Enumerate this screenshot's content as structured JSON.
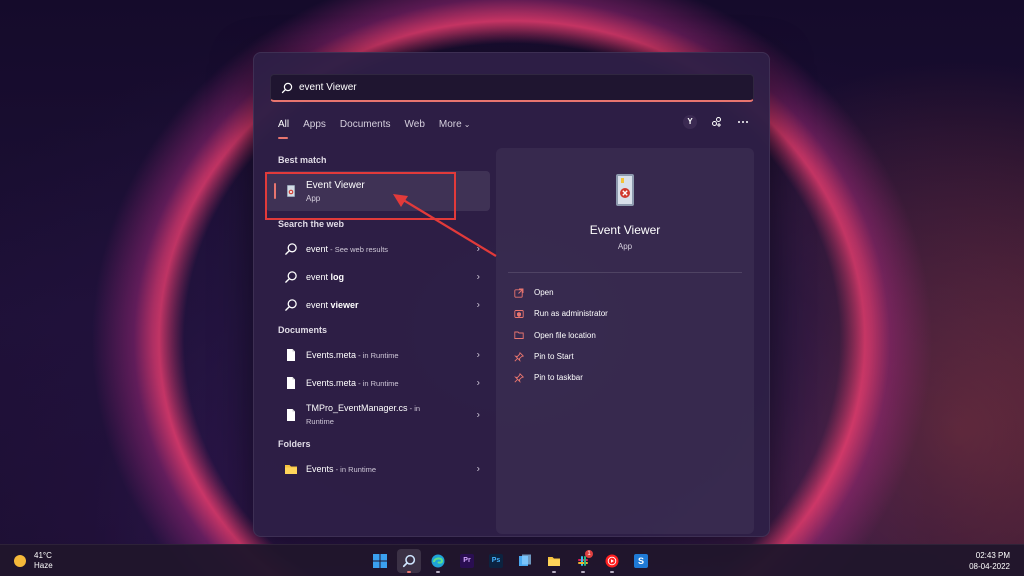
{
  "search": {
    "value": "event Viewer"
  },
  "tabs": [
    {
      "label": "All"
    },
    {
      "label": "Apps"
    },
    {
      "label": "Documents"
    },
    {
      "label": "Web"
    },
    {
      "label": "More"
    }
  ],
  "account": {
    "initial": "Y"
  },
  "best_match": {
    "section": "Best match",
    "title": "Event Viewer",
    "type": "App"
  },
  "web": {
    "section": "Search the web",
    "items": [
      {
        "term": "event",
        "suffix": " - See web results"
      },
      {
        "term_plain": "event ",
        "term_bold": "log"
      },
      {
        "term_plain": "event ",
        "term_bold": "viewer"
      }
    ]
  },
  "documents": {
    "section": "Documents",
    "items": [
      {
        "name": "Events.meta",
        "location": " - in Runtime"
      },
      {
        "name": "Events.meta",
        "location": " - in Runtime"
      },
      {
        "name": "TMPro_EventManager.cs",
        "location": " - in",
        "location2": "Runtime"
      }
    ]
  },
  "folders": {
    "section": "Folders",
    "items": [
      {
        "name": "Events",
        "location": " - in Runtime"
      }
    ]
  },
  "preview": {
    "title": "Event Viewer",
    "type": "App",
    "actions": [
      {
        "label": "Open",
        "icon": "open-icon"
      },
      {
        "label": "Run as administrator",
        "icon": "shield-icon"
      },
      {
        "label": "Open file location",
        "icon": "folder-icon"
      },
      {
        "label": "Pin to Start",
        "icon": "pin-icon"
      },
      {
        "label": "Pin to taskbar",
        "icon": "pin-icon"
      }
    ]
  },
  "taskbar": {
    "weather_temp": "41°C",
    "weather_desc": "Haze",
    "time": "02:43 PM",
    "date": "08-04-2022",
    "apps": [
      {
        "name": "start-button",
        "label": ""
      },
      {
        "name": "search-button",
        "label": ""
      },
      {
        "name": "edge",
        "label": ""
      },
      {
        "name": "premiere-pro",
        "label": "Pr"
      },
      {
        "name": "photoshop",
        "label": "Ps"
      },
      {
        "name": "task-view",
        "label": ""
      },
      {
        "name": "file-explorer",
        "label": ""
      },
      {
        "name": "slack",
        "label": "",
        "badge": "1"
      },
      {
        "name": "youtube-music",
        "label": ""
      },
      {
        "name": "snagit",
        "label": "S"
      }
    ]
  },
  "colors": {
    "accent": "#e8756f",
    "annotation": "#e23a3a",
    "panel": "#2e1f46"
  }
}
